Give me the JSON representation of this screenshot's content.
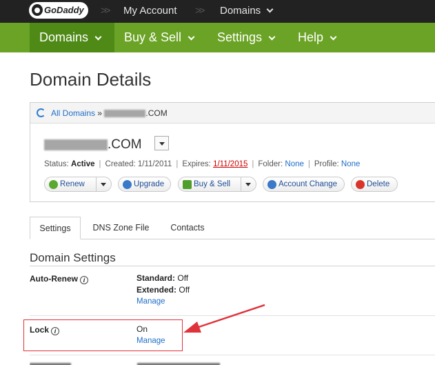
{
  "topbar": {
    "logo": "GoDaddy",
    "breadcrumbs": [
      "My Account",
      "Domains"
    ]
  },
  "nav": {
    "tabs": [
      "Domains",
      "Buy & Sell",
      "Settings",
      "Help"
    ]
  },
  "page": {
    "title": "Domain Details"
  },
  "panel": {
    "breadcrumb_link": "All Domains",
    "breadcrumb_sep": "»",
    "breadcrumb_suffix": ".COM",
    "domain_suffix": ".COM",
    "status_label": "Status:",
    "status_value": "Active",
    "created_label": "Created:",
    "created_value": "1/11/2011",
    "expires_label": "Expires:",
    "expires_value": "1/11/2015",
    "folder_label": "Folder:",
    "folder_value": "None",
    "profile_label": "Profile:",
    "profile_value": "None",
    "buttons": {
      "renew": "Renew",
      "upgrade": "Upgrade",
      "buy_sell": "Buy & Sell",
      "account_change": "Account Change",
      "delete": "Delete"
    }
  },
  "tabs": [
    "Settings",
    "DNS Zone File",
    "Contacts"
  ],
  "settings": {
    "section_title": "Domain Settings",
    "auto_renew": {
      "label": "Auto-Renew",
      "standard_label": "Standard:",
      "standard_value": "Off",
      "extended_label": "Extended:",
      "extended_value": "Off",
      "manage": "Manage"
    },
    "lock": {
      "label": "Lock",
      "value": "On",
      "manage": "Manage"
    }
  },
  "colors": {
    "topbar": "#222222",
    "nav_green": "#6aa325",
    "nav_active": "#4f8a17",
    "link": "#1f6fc8",
    "expiry_red": "#cc0000",
    "annotation_red": "#e0323a"
  }
}
